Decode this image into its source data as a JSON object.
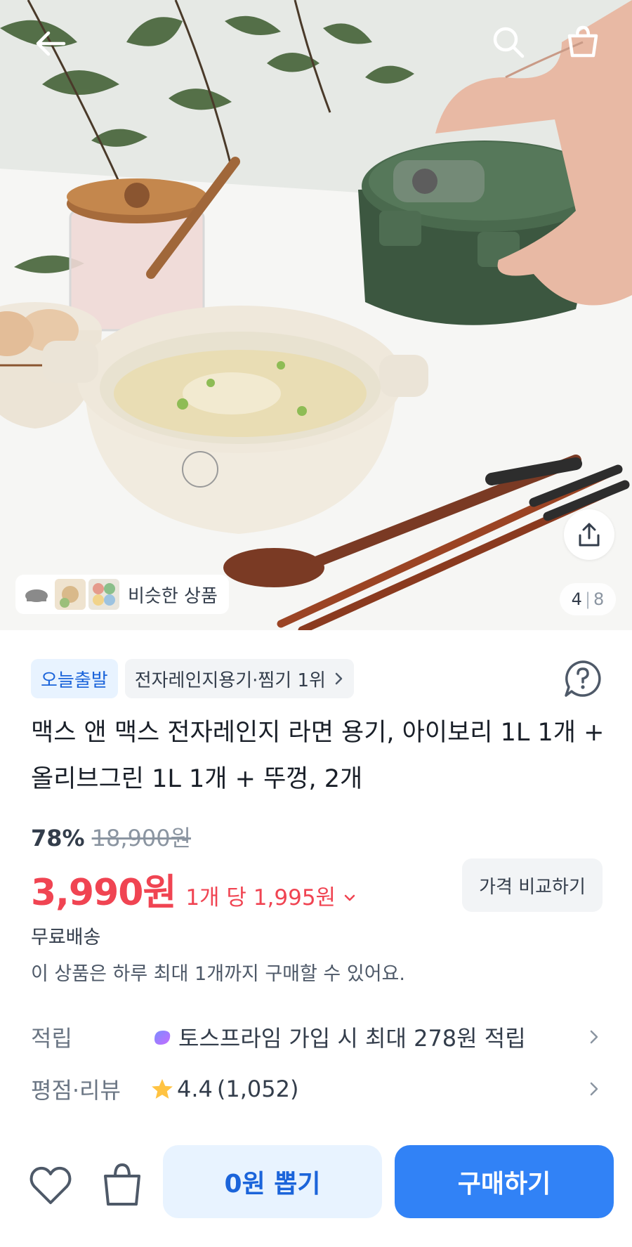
{
  "gallery": {
    "current": "4",
    "separator": "|",
    "total": "8",
    "similar_label": "비슷한 상품"
  },
  "tags": {
    "delivery": "오늘출발",
    "ranking": "전자레인지용기·찜기 1위"
  },
  "product": {
    "title": "맥스 앤 맥스 전자레인지 라면 용기, 아이보리 1L 1개 + 올리브그린 1L 1개 + 뚜껑, 2개",
    "discount": "78%",
    "original_price": "18,900원",
    "price": "3,990원",
    "unit_price": "1개 당 1,995원",
    "compare_button": "가격 비교하기",
    "shipping": "무료배송",
    "purchase_limit": "이 상품은 하루 최대 1개까지 구매할 수 있어요."
  },
  "info": {
    "points_label": "적립",
    "points_value": "토스프라임 가입 시 최대 278원 적립",
    "review_label": "평점·리뷰",
    "rating": "4.4",
    "review_count": "(1,052)"
  },
  "actions": {
    "draw_label": "0원 뽑기",
    "buy_label": "구매하기"
  },
  "colors": {
    "accent_blue": "#3182f6",
    "price_red": "#f04452",
    "tag_blue_bg": "#e8f3ff",
    "star": "#ffc342",
    "container_green": "#3f5a44"
  },
  "icons": [
    "back-arrow-icon",
    "search-icon",
    "cart-icon",
    "share-icon",
    "help-icon",
    "chevron-right-icon",
    "chevron-down-icon",
    "prime-logo-icon",
    "star-icon",
    "heart-icon",
    "bag-icon"
  ]
}
